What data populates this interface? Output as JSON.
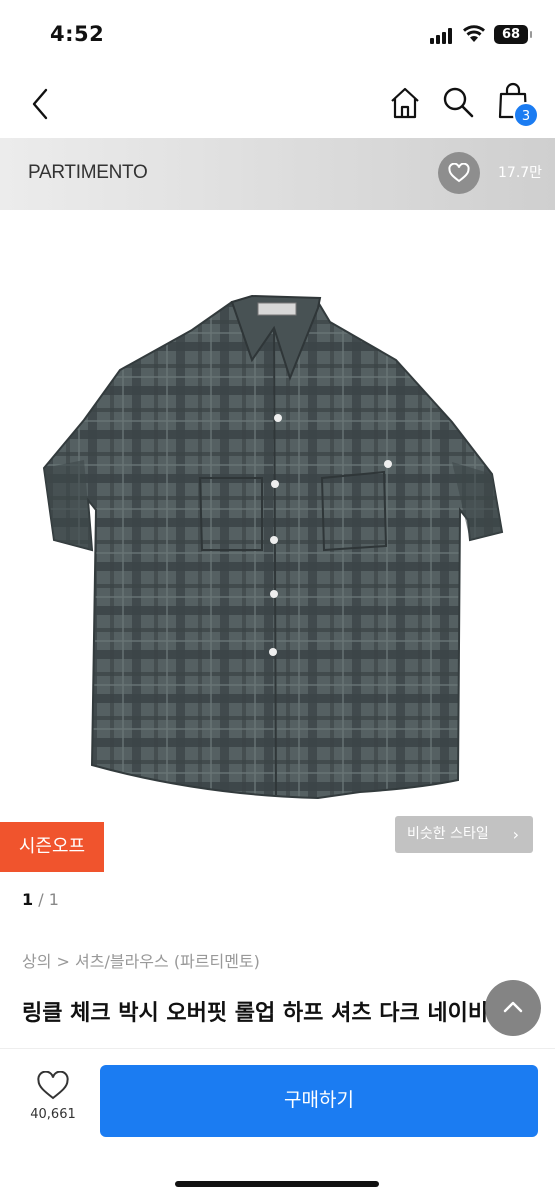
{
  "status_bar": {
    "time": "4:52",
    "battery": "68"
  },
  "nav": {
    "cart_count": "3"
  },
  "brand": {
    "name": "PARTIMENTO",
    "likes": "17.7만"
  },
  "badge": {
    "season": "시즌오프"
  },
  "similar": {
    "label": "비슷한 스타일",
    "chevron": "›"
  },
  "pager": {
    "current": "1",
    "total": "/ 1"
  },
  "breadcrumb": "상의 > 셔츠/블라우스 (파르티멘토)",
  "product": {
    "title": "링클 체크 박시 오버핏 롤업 하프 셔츠 다크 네이비"
  },
  "bottom": {
    "like_count": "40,661",
    "buy_label": "구매하기"
  },
  "colors": {
    "accent": "#1b7cf2",
    "season_badge": "#f0542d",
    "shirt": "#4b5557"
  }
}
